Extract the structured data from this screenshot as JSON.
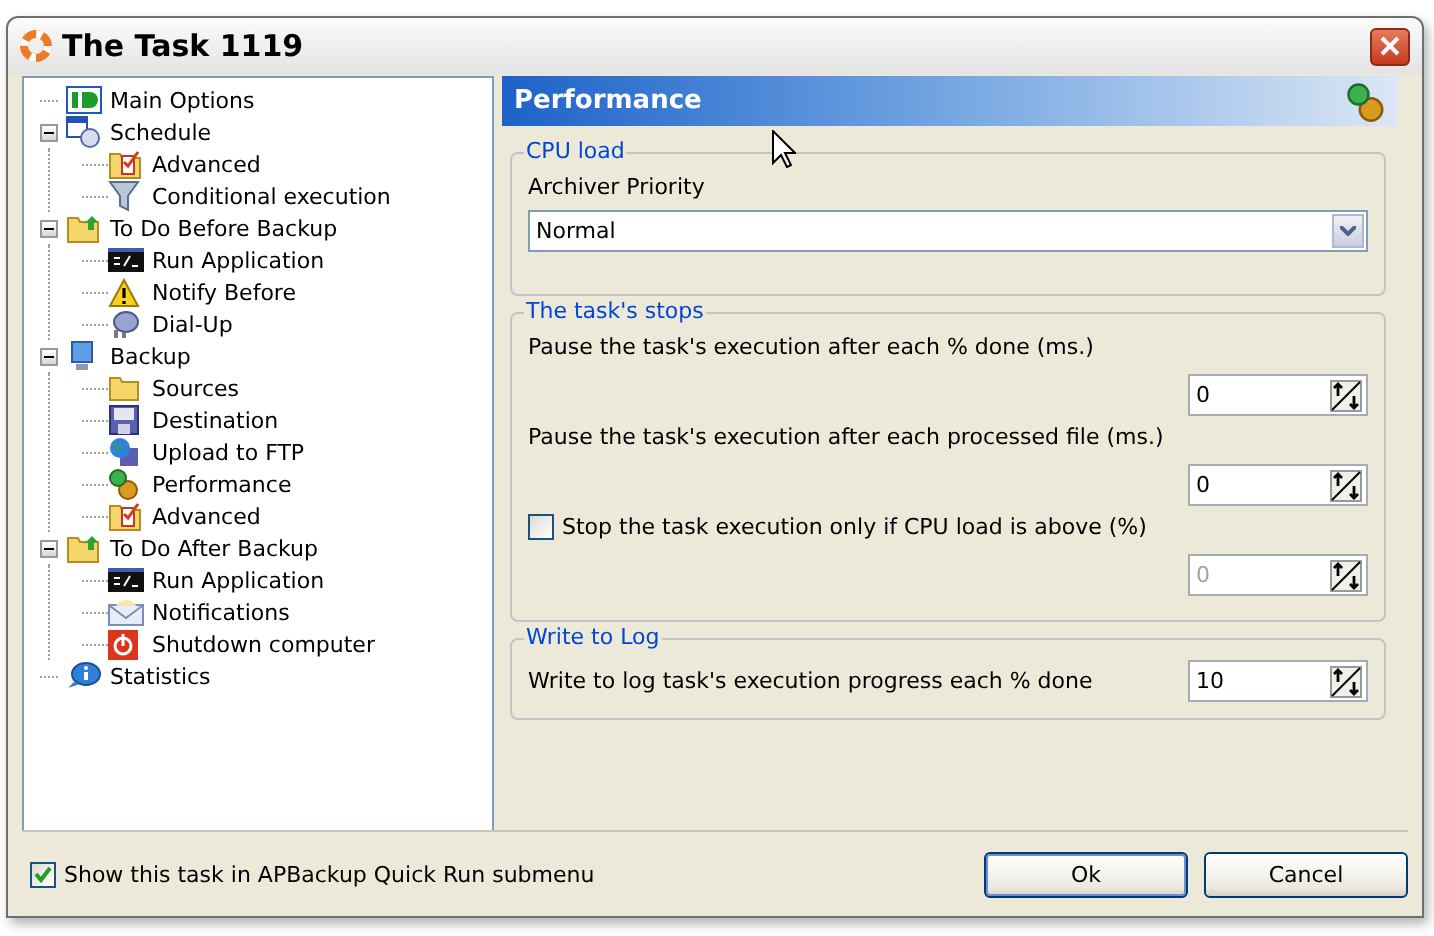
{
  "window": {
    "title": "The Task 1119"
  },
  "tree": [
    {
      "label": "Main Options"
    },
    {
      "label": "Schedule",
      "expanded": true,
      "children": [
        {
          "label": "Advanced"
        },
        {
          "label": "Conditional execution"
        }
      ]
    },
    {
      "label": "To Do Before Backup",
      "expanded": true,
      "children": [
        {
          "label": "Run Application"
        },
        {
          "label": "Notify Before"
        },
        {
          "label": "Dial-Up"
        }
      ]
    },
    {
      "label": "Backup",
      "expanded": true,
      "children": [
        {
          "label": "Sources"
        },
        {
          "label": "Destination"
        },
        {
          "label": "Upload to FTP"
        },
        {
          "label": "Performance"
        },
        {
          "label": "Advanced"
        }
      ]
    },
    {
      "label": "To Do After Backup",
      "expanded": true,
      "children": [
        {
          "label": "Run Application"
        },
        {
          "label": "Notifications"
        },
        {
          "label": "Shutdown computer"
        }
      ]
    },
    {
      "label": "Statistics"
    }
  ],
  "panel": {
    "title": "Performance",
    "cpu_load": {
      "title": "CPU load",
      "label": "Archiver Priority",
      "value": "Normal"
    },
    "stops": {
      "title": "The task's stops",
      "rows": [
        {
          "kind": "label",
          "label": "Pause the task's execution after each % done (ms.)",
          "value": "0",
          "disabled": false
        },
        {
          "kind": "label",
          "label": "Pause the task's execution after each processed file (ms.)",
          "value": "0",
          "disabled": false
        },
        {
          "kind": "checkbox",
          "label": "Stop the task execution only if CPU load is above (%)",
          "checked": false,
          "value": "0",
          "disabled": true
        }
      ]
    },
    "log": {
      "title": "Write to Log",
      "label": "Write to log task's execution progress each % done",
      "value": "10",
      "disabled": false
    }
  },
  "footer": {
    "checkbox": {
      "label": "Show this task in APBackup Quick Run submenu",
      "checked": true
    },
    "buttons": [
      "Ok",
      "Cancel"
    ]
  }
}
